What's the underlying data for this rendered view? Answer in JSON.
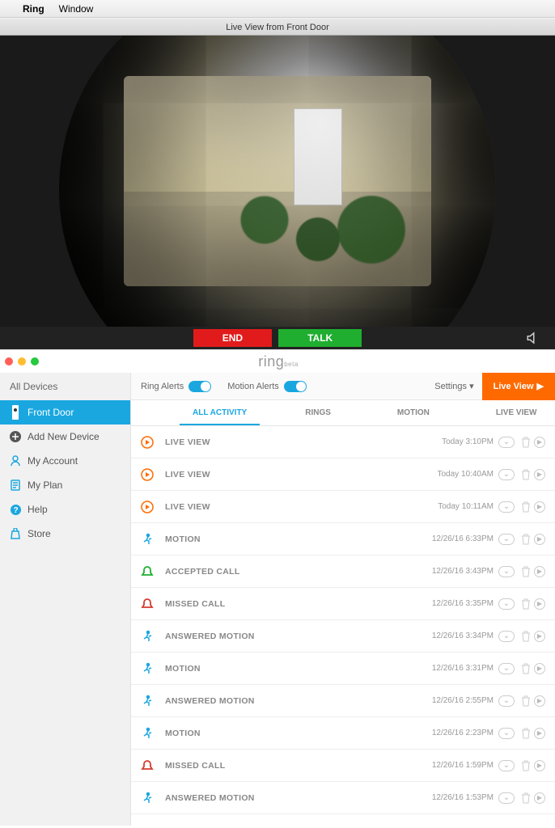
{
  "menubar": {
    "app": "Ring",
    "menu1": "Window"
  },
  "video": {
    "title": "Live View from Front Door",
    "end_label": "END",
    "talk_label": "TALK"
  },
  "app": {
    "logo": "ring",
    "logo_sub": "beta"
  },
  "sidebar": {
    "header": "All Devices",
    "active": "Front Door",
    "add": "Add New Device",
    "account": "My Account",
    "plan": "My Plan",
    "help": "Help",
    "store": "Store"
  },
  "toolbar": {
    "ring_alerts": "Ring Alerts",
    "motion_alerts": "Motion Alerts",
    "settings": "Settings",
    "live_view": "Live View"
  },
  "tabs": {
    "all": "ALL ACTIVITY",
    "rings": "RINGS",
    "motion": "MOTION",
    "live": "LIVE VIEW"
  },
  "events": [
    {
      "type": "live",
      "label": "LIVE VIEW",
      "time": "Today 3:10PM"
    },
    {
      "type": "live",
      "label": "LIVE VIEW",
      "time": "Today 10:40AM"
    },
    {
      "type": "live",
      "label": "LIVE VIEW",
      "time": "Today 10:11AM"
    },
    {
      "type": "motion",
      "label": "MOTION",
      "time": "12/26/16 6:33PM"
    },
    {
      "type": "accept",
      "label": "ACCEPTED CALL",
      "time": "12/26/16 3:43PM"
    },
    {
      "type": "missed",
      "label": "MISSED CALL",
      "time": "12/26/16 3:35PM"
    },
    {
      "type": "motion",
      "label": "ANSWERED MOTION",
      "time": "12/26/16 3:34PM"
    },
    {
      "type": "motion",
      "label": "MOTION",
      "time": "12/26/16 3:31PM"
    },
    {
      "type": "motion",
      "label": "ANSWERED MOTION",
      "time": "12/26/16 2:55PM"
    },
    {
      "type": "motion",
      "label": "MOTION",
      "time": "12/26/16 2:23PM"
    },
    {
      "type": "missed",
      "label": "MISSED CALL",
      "time": "12/26/16 1:59PM"
    },
    {
      "type": "motion",
      "label": "ANSWERED MOTION",
      "time": "12/26/16 1:53PM"
    }
  ]
}
